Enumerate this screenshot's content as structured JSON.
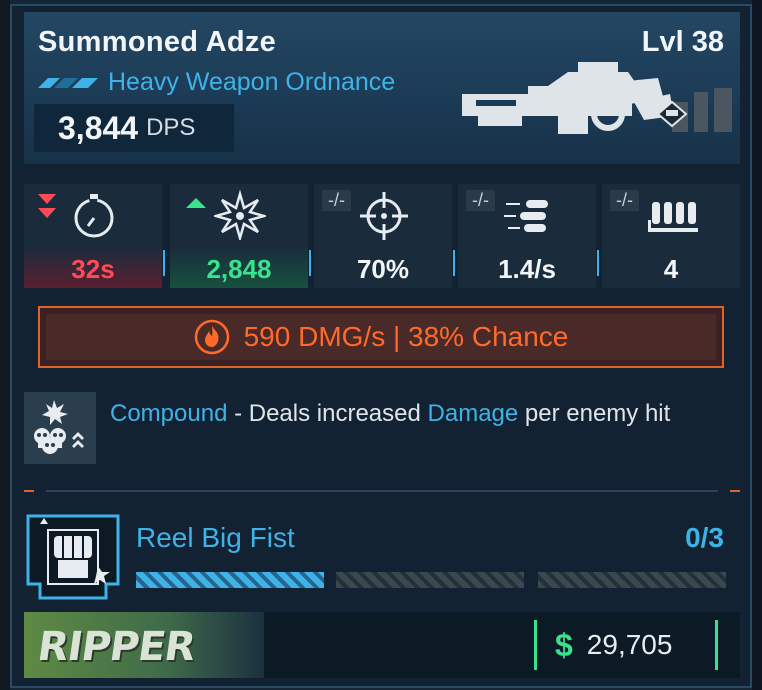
{
  "item": {
    "name": "Summoned Adze",
    "level": "Lvl 38",
    "type": "Heavy Weapon Ordnance",
    "dps_value": "3,844",
    "dps_label": "DPS"
  },
  "stats": [
    {
      "icon": "stopwatch-icon",
      "value": "32s",
      "delta": "",
      "trend": "down"
    },
    {
      "icon": "damage-burst-icon",
      "value": "2,848",
      "delta": "",
      "trend": "up"
    },
    {
      "icon": "crosshair-icon",
      "value": "70%",
      "delta": "-/-",
      "trend": "none"
    },
    {
      "icon": "fire-rate-icon",
      "value": "1.4/s",
      "delta": "-/-",
      "trend": "none"
    },
    {
      "icon": "ammo-icon",
      "value": "4",
      "delta": "-/-",
      "trend": "none"
    }
  ],
  "element": {
    "icon": "fire-icon",
    "text": "590 DMG/s | 38% Chance",
    "color": "#e0642a"
  },
  "perk": {
    "icon": "skulls-icon",
    "name": "Compound",
    "sep": " - Deals increased ",
    "keyword": "Damage",
    "tail": " per enemy hit"
  },
  "anointment": {
    "icon": "fist-icon",
    "name": "Reel Big Fist",
    "progress": "0/3"
  },
  "footer": {
    "manufacturer": "RIPPER",
    "currency_icon": "$",
    "price": "29,705"
  },
  "colors": {
    "accent": "#3fb3e8",
    "positive": "#39e28c",
    "negative": "#ff4a5a"
  }
}
